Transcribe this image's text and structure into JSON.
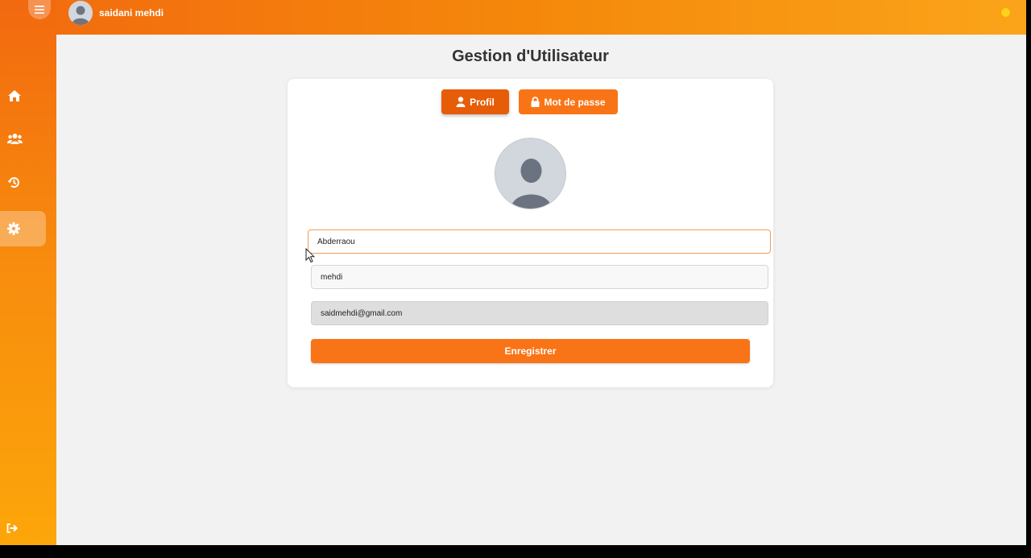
{
  "header": {
    "user_name": "saidani mehdi",
    "icons": {
      "menu": "hamburger-icon",
      "avatar": "user-avatar-icon",
      "status": "status-dot"
    }
  },
  "sidebar": {
    "items": [
      {
        "name": "home",
        "icon": "home-icon",
        "active": false
      },
      {
        "name": "users",
        "icon": "users-icon",
        "active": false
      },
      {
        "name": "history",
        "icon": "history-icon",
        "active": false
      },
      {
        "name": "settings",
        "icon": "gear-icon",
        "active": true
      }
    ],
    "logout_icon": "logout-icon"
  },
  "page": {
    "title": "Gestion d'Utilisateur"
  },
  "tabs": [
    {
      "label": "Profil",
      "icon": "user-icon",
      "active": true
    },
    {
      "label": "Mot de passe",
      "icon": "lock-icon",
      "active": false
    }
  ],
  "form": {
    "prenom_value": "Abderraou",
    "nom_value": "mehdi",
    "email_value": "saidmehdi@gmail.com",
    "save_label": "Enregistrer"
  },
  "colors": {
    "accent": "#f97416",
    "accent_dark": "#e75d07",
    "sidebar_top": "#f2690f",
    "sidebar_bottom": "#fca60a"
  }
}
